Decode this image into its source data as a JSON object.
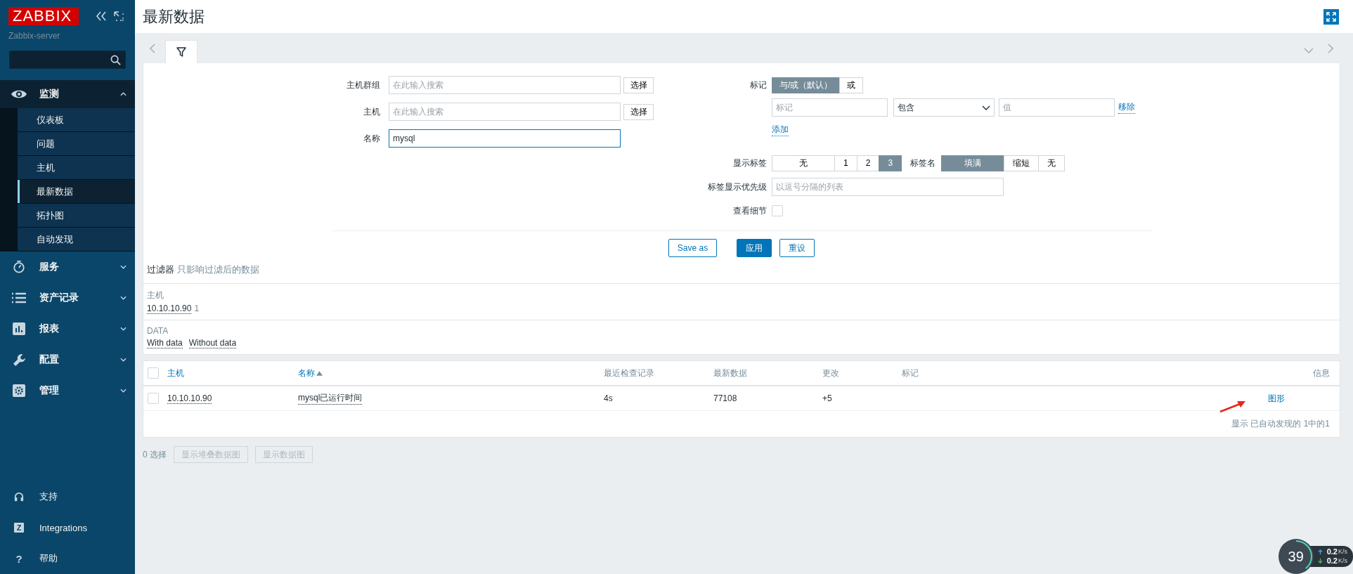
{
  "sidebar": {
    "logo": "ZABBIX",
    "server": "Zabbix-server",
    "menu": [
      {
        "label": "监测",
        "expanded": true,
        "children": [
          {
            "label": "仪表板",
            "selected": false
          },
          {
            "label": "问题",
            "selected": false
          },
          {
            "label": "主机",
            "selected": false
          },
          {
            "label": "最新数据",
            "selected": true
          },
          {
            "label": "拓扑图",
            "selected": false
          },
          {
            "label": "自动发现",
            "selected": false
          }
        ]
      },
      {
        "label": "服务",
        "expanded": false
      },
      {
        "label": "资产记录",
        "expanded": false
      },
      {
        "label": "报表",
        "expanded": false
      },
      {
        "label": "配置",
        "expanded": false
      },
      {
        "label": "管理",
        "expanded": false
      }
    ],
    "footer": [
      {
        "label": "支持"
      },
      {
        "label": "Integrations",
        "glyph": "Z"
      },
      {
        "label": "帮助",
        "glyph": "?"
      }
    ]
  },
  "header": {
    "title": "最新数据"
  },
  "filter": {
    "fields": [
      {
        "label": "主机群组",
        "placeholder": "在此输入搜索",
        "button": "选择",
        "focused": false
      },
      {
        "label": "主机",
        "placeholder": "在此输入搜索",
        "button": "选择",
        "focused": false
      },
      {
        "label": "名称",
        "value": "mysql",
        "focused": true
      }
    ],
    "tags": {
      "label": "标记",
      "operators": [
        {
          "label": "与/或（默认）",
          "selected": true
        },
        {
          "label": "或",
          "selected": false
        }
      ],
      "tag_placeholder": "标记",
      "operator": "包含",
      "value_placeholder": "值",
      "remove": "移除",
      "add": "添加"
    },
    "show_tags": {
      "label": "显示标签",
      "options": [
        {
          "label": "无",
          "selected": false
        },
        {
          "label": "1",
          "selected": false
        },
        {
          "label": "2",
          "selected": false
        },
        {
          "label": "3",
          "selected": true
        }
      ]
    },
    "tag_name": {
      "label": "标签名",
      "options": [
        {
          "label": "填满",
          "selected": true
        },
        {
          "label": "缩短",
          "selected": false
        },
        {
          "label": "无",
          "selected": false
        }
      ]
    },
    "priority": {
      "label": "标签显示优先级",
      "placeholder": "以逗号分隔的列表"
    },
    "details": {
      "label": "查看细节",
      "checked": false
    },
    "actions": [
      {
        "label": "Save as",
        "kind": "outline"
      },
      {
        "label": "应用",
        "kind": "primary"
      },
      {
        "label": "重设",
        "kind": "outline"
      }
    ],
    "summary": {
      "title": "过滤器",
      "note": "只影响过滤后的数据"
    }
  },
  "subfilters": [
    {
      "title": "主机",
      "items": [
        {
          "label": "10.10.10.90",
          "count": "1"
        }
      ]
    },
    {
      "title": "DATA",
      "items": [
        {
          "label": "With data"
        },
        {
          "label": "Without data"
        }
      ]
    }
  ],
  "table": {
    "select_all_checked": false,
    "columns": [
      {
        "label": "主机",
        "sortable": true,
        "sorted": false
      },
      {
        "label": "名称",
        "sortable": true,
        "sorted": true
      },
      {
        "label": "最近检查记录",
        "sortable": false,
        "sorted": false
      },
      {
        "label": "最新数据",
        "sortable": false,
        "sorted": false
      },
      {
        "label": "更改",
        "sortable": false,
        "sorted": false
      },
      {
        "label": "标记",
        "sortable": false,
        "sorted": false
      },
      {
        "label": "信息",
        "sortable": false,
        "sorted": false
      }
    ],
    "rows": [
      {
        "checked": false,
        "host": "10.10.10.90",
        "name": "mysql已运行时间",
        "last_check": "4s",
        "last_value": "77108",
        "change": "+5",
        "info": "图形"
      }
    ],
    "footer": "显示 已自动发现的 1中的1"
  },
  "bottom": {
    "count": "0 选择",
    "buttons": [
      {
        "label": "显示堆叠数据图",
        "disabled": true
      },
      {
        "label": "显示数据图",
        "disabled": true
      }
    ]
  },
  "net_widget": {
    "load": "39",
    "upload": "0.2",
    "upload_unit": "K/s",
    "download": "0.2",
    "download_unit": "K/s"
  }
}
